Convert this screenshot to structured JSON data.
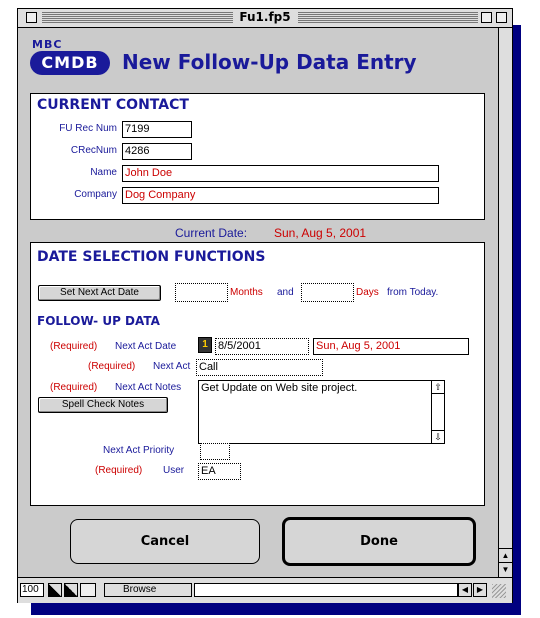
{
  "window": {
    "title": "Fu1.fp5"
  },
  "header": {
    "logo_top": "MBC",
    "logo_main": "CMDB",
    "title": "New Follow-Up Data Entry"
  },
  "current_contact": {
    "heading": "CURRENT CONTACT",
    "fu_rec_num_label": "FU Rec Num",
    "fu_rec_num": "7199",
    "crec_num_label": "CRecNum",
    "crec_num": "4286",
    "name_label": "Name",
    "name": "John Doe",
    "company_label": "Company",
    "company": "Dog Company"
  },
  "current_date": {
    "label": "Current Date:",
    "value": "Sun, Aug 5, 2001"
  },
  "date_selection": {
    "heading": "DATE SELECTION FUNCTIONS",
    "set_button": "Set Next Act Date",
    "months_label": "Months",
    "and_label": "and",
    "days_label": "Days",
    "from_today_label": "from Today."
  },
  "followup": {
    "heading": "FOLLOW- UP DATA",
    "required_tag": "(Required)",
    "next_act_date_label": "Next Act Date",
    "next_act_date": "8/5/2001",
    "next_act_date_long": "Sun, Aug 5, 2001",
    "next_act_label": "Next Act",
    "next_act": "Call",
    "next_act_notes_label": "Next Act Notes",
    "next_act_notes": "Get Update on Web site project.",
    "spell_check_button": "Spell Check Notes",
    "priority_label": "Next Act Priority",
    "priority": "",
    "user_label": "User",
    "user": "EA"
  },
  "buttons": {
    "cancel": "Cancel",
    "done": "Done"
  },
  "status": {
    "zoom": "100",
    "mode": "Browse"
  },
  "colors": {
    "navy": "#1a1a9a",
    "required_red": "#cc0000",
    "shadow": "#000080"
  }
}
